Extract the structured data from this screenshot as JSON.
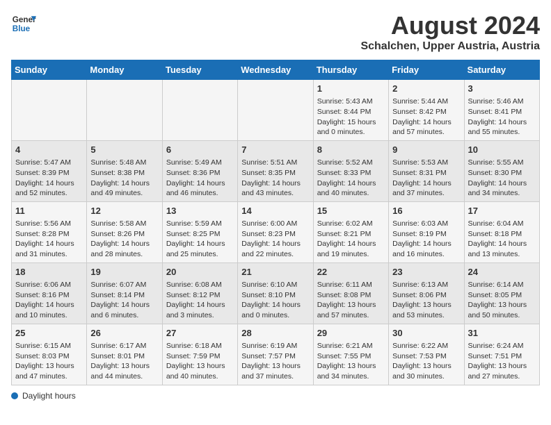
{
  "header": {
    "logo_line1": "General",
    "logo_line2": "Blue",
    "main_title": "August 2024",
    "subtitle": "Schalchen, Upper Austria, Austria"
  },
  "weekdays": [
    "Sunday",
    "Monday",
    "Tuesday",
    "Wednesday",
    "Thursday",
    "Friday",
    "Saturday"
  ],
  "weeks": [
    [
      {
        "day": "",
        "info": ""
      },
      {
        "day": "",
        "info": ""
      },
      {
        "day": "",
        "info": ""
      },
      {
        "day": "",
        "info": ""
      },
      {
        "day": "1",
        "info": "Sunrise: 5:43 AM\nSunset: 8:44 PM\nDaylight: 15 hours and 0 minutes."
      },
      {
        "day": "2",
        "info": "Sunrise: 5:44 AM\nSunset: 8:42 PM\nDaylight: 14 hours and 57 minutes."
      },
      {
        "day": "3",
        "info": "Sunrise: 5:46 AM\nSunset: 8:41 PM\nDaylight: 14 hours and 55 minutes."
      }
    ],
    [
      {
        "day": "4",
        "info": "Sunrise: 5:47 AM\nSunset: 8:39 PM\nDaylight: 14 hours and 52 minutes."
      },
      {
        "day": "5",
        "info": "Sunrise: 5:48 AM\nSunset: 8:38 PM\nDaylight: 14 hours and 49 minutes."
      },
      {
        "day": "6",
        "info": "Sunrise: 5:49 AM\nSunset: 8:36 PM\nDaylight: 14 hours and 46 minutes."
      },
      {
        "day": "7",
        "info": "Sunrise: 5:51 AM\nSunset: 8:35 PM\nDaylight: 14 hours and 43 minutes."
      },
      {
        "day": "8",
        "info": "Sunrise: 5:52 AM\nSunset: 8:33 PM\nDaylight: 14 hours and 40 minutes."
      },
      {
        "day": "9",
        "info": "Sunrise: 5:53 AM\nSunset: 8:31 PM\nDaylight: 14 hours and 37 minutes."
      },
      {
        "day": "10",
        "info": "Sunrise: 5:55 AM\nSunset: 8:30 PM\nDaylight: 14 hours and 34 minutes."
      }
    ],
    [
      {
        "day": "11",
        "info": "Sunrise: 5:56 AM\nSunset: 8:28 PM\nDaylight: 14 hours and 31 minutes."
      },
      {
        "day": "12",
        "info": "Sunrise: 5:58 AM\nSunset: 8:26 PM\nDaylight: 14 hours and 28 minutes."
      },
      {
        "day": "13",
        "info": "Sunrise: 5:59 AM\nSunset: 8:25 PM\nDaylight: 14 hours and 25 minutes."
      },
      {
        "day": "14",
        "info": "Sunrise: 6:00 AM\nSunset: 8:23 PM\nDaylight: 14 hours and 22 minutes."
      },
      {
        "day": "15",
        "info": "Sunrise: 6:02 AM\nSunset: 8:21 PM\nDaylight: 14 hours and 19 minutes."
      },
      {
        "day": "16",
        "info": "Sunrise: 6:03 AM\nSunset: 8:19 PM\nDaylight: 14 hours and 16 minutes."
      },
      {
        "day": "17",
        "info": "Sunrise: 6:04 AM\nSunset: 8:18 PM\nDaylight: 14 hours and 13 minutes."
      }
    ],
    [
      {
        "day": "18",
        "info": "Sunrise: 6:06 AM\nSunset: 8:16 PM\nDaylight: 14 hours and 10 minutes."
      },
      {
        "day": "19",
        "info": "Sunrise: 6:07 AM\nSunset: 8:14 PM\nDaylight: 14 hours and 6 minutes."
      },
      {
        "day": "20",
        "info": "Sunrise: 6:08 AM\nSunset: 8:12 PM\nDaylight: 14 hours and 3 minutes."
      },
      {
        "day": "21",
        "info": "Sunrise: 6:10 AM\nSunset: 8:10 PM\nDaylight: 14 hours and 0 minutes."
      },
      {
        "day": "22",
        "info": "Sunrise: 6:11 AM\nSunset: 8:08 PM\nDaylight: 13 hours and 57 minutes."
      },
      {
        "day": "23",
        "info": "Sunrise: 6:13 AM\nSunset: 8:06 PM\nDaylight: 13 hours and 53 minutes."
      },
      {
        "day": "24",
        "info": "Sunrise: 6:14 AM\nSunset: 8:05 PM\nDaylight: 13 hours and 50 minutes."
      }
    ],
    [
      {
        "day": "25",
        "info": "Sunrise: 6:15 AM\nSunset: 8:03 PM\nDaylight: 13 hours and 47 minutes."
      },
      {
        "day": "26",
        "info": "Sunrise: 6:17 AM\nSunset: 8:01 PM\nDaylight: 13 hours and 44 minutes."
      },
      {
        "day": "27",
        "info": "Sunrise: 6:18 AM\nSunset: 7:59 PM\nDaylight: 13 hours and 40 minutes."
      },
      {
        "day": "28",
        "info": "Sunrise: 6:19 AM\nSunset: 7:57 PM\nDaylight: 13 hours and 37 minutes."
      },
      {
        "day": "29",
        "info": "Sunrise: 6:21 AM\nSunset: 7:55 PM\nDaylight: 13 hours and 34 minutes."
      },
      {
        "day": "30",
        "info": "Sunrise: 6:22 AM\nSunset: 7:53 PM\nDaylight: 13 hours and 30 minutes."
      },
      {
        "day": "31",
        "info": "Sunrise: 6:24 AM\nSunset: 7:51 PM\nDaylight: 13 hours and 27 minutes."
      }
    ]
  ],
  "footer": {
    "daylight_label": "Daylight hours"
  }
}
